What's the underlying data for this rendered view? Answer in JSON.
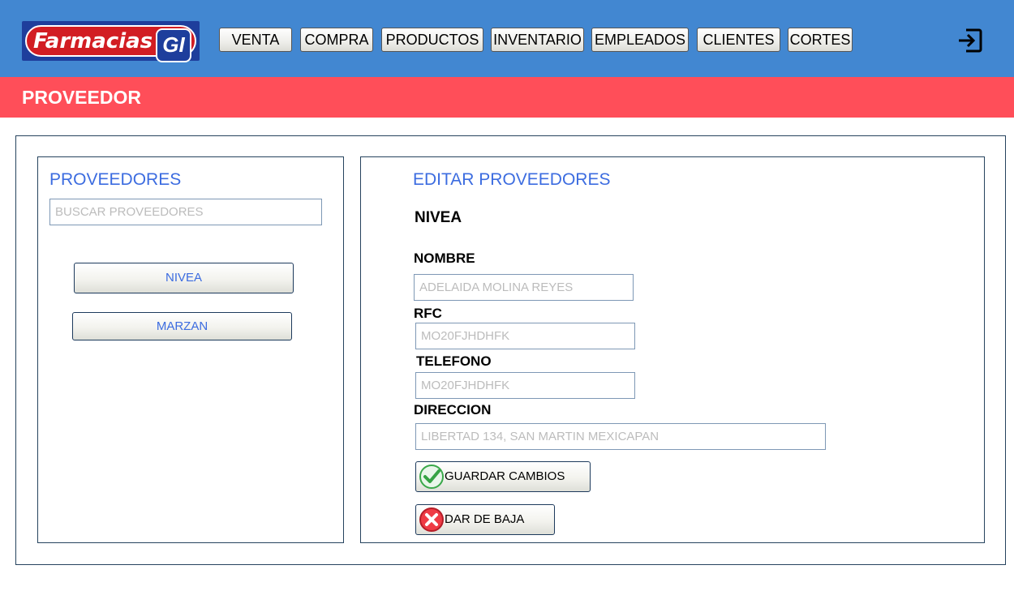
{
  "brand": {
    "logo_text": "Farmacias",
    "logo_badge": "GI"
  },
  "nav": {
    "items": [
      {
        "label": "VENTA"
      },
      {
        "label": "COMPRA"
      },
      {
        "label": "PRODUCTOS"
      },
      {
        "label": "INVENTARIO"
      },
      {
        "label": "EMPLEADOS"
      },
      {
        "label": "CLIENTES"
      },
      {
        "label": "CORTES"
      }
    ],
    "exit_icon": "logout-icon"
  },
  "page": {
    "title": "PROVEEDOR"
  },
  "sidebar": {
    "title": "PROVEEDORES",
    "search_placeholder": "BUSCAR PROVEEDORES",
    "items": [
      {
        "label": "NIVEA"
      },
      {
        "label": "MARZAN"
      }
    ]
  },
  "editor": {
    "title": "EDITAR PROVEEDORES",
    "selected_name": "NIVEA",
    "fields": {
      "nombre": {
        "label": "NOMBRE",
        "placeholder": "ADELAIDA MOLINA REYES"
      },
      "rfc": {
        "label": "RFC",
        "placeholder": "MO20FJHDHFK"
      },
      "telefono": {
        "label": "TELEFONO",
        "placeholder": "MO20FJHDHFK"
      },
      "direccion": {
        "label": "DIRECCION",
        "placeholder": "LIBERTAD 134, SAN MARTIN MEXICAPAN"
      }
    },
    "save_label": "GUARDAR CAMBIOS",
    "delete_label": "DAR DE BAJA"
  },
  "colors": {
    "topbar": "#4287d1",
    "pagebar": "#ff4e59",
    "accent_text": "#3c6ce0",
    "border": "#26435e"
  }
}
